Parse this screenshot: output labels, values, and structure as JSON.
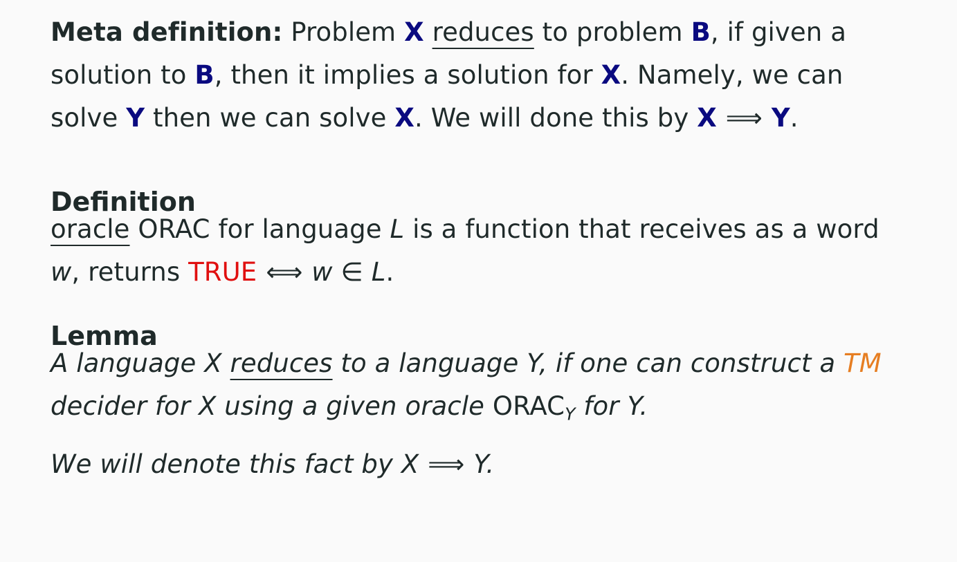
{
  "meta": {
    "label": "Meta definition:",
    "t1": "Problem",
    "X": "X",
    "reduces": "reduces",
    "t2": "to problem",
    "B": "B",
    "t3": ", if given a",
    "t4": "solution to",
    "t5": ", then it implies a solution for",
    "t6": ". Namely, we can",
    "t7": "solve",
    "Y": "Y",
    "t8": "then we can solve",
    "t9": ". We will done this by",
    "arrow": "⟹",
    "t10": "."
  },
  "definition": {
    "heading": "Definition",
    "oracle": "oracle",
    "t1": "ORAC for language",
    "L": "L",
    "t2": "is a function that receives as a word",
    "w": "w",
    "t3": ", returns",
    "true_label": "TRUE",
    "iff": "⟺",
    "in": "∈",
    "t4": "."
  },
  "lemma": {
    "heading": "Lemma",
    "t1": "A language",
    "X": "X",
    "reduces": "reduces",
    "t2": "to a language",
    "Y": "Y",
    "t3": ", if one can construct a",
    "tm": "TM",
    "t4": "decider for",
    "t5": "using a given oracle",
    "orac": "ORAC",
    "sub": "Y",
    "t6": "for",
    "t7": ".",
    "t8": "We will denote this fact by",
    "arrow": "⟹",
    "t9": "."
  }
}
